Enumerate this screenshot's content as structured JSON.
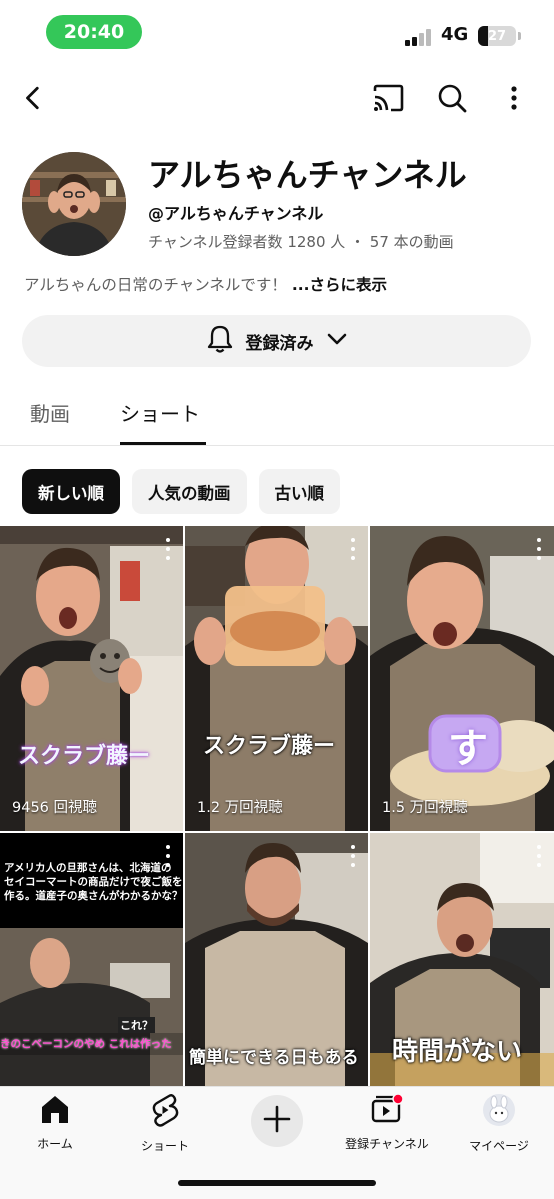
{
  "status_bar": {
    "time": "20:40",
    "network": "4G",
    "battery": "27"
  },
  "topbar": {
    "back_icon": "chevron-left-icon",
    "cast_icon": "cast-icon",
    "search_icon": "search-icon",
    "more_icon": "more-vert-icon"
  },
  "channel": {
    "name": "アルちゃんチャンネル",
    "handle": "@アルちゃんチャンネル",
    "stats": "チャンネル登録者数 1280 人 ・ 57 本の動画",
    "description": "アルちゃんの日常のチャンネルです！",
    "more": "...さらに表示",
    "subscribe_label": "登録済み"
  },
  "tabs": [
    {
      "label": "動画"
    },
    {
      "label": "ショート"
    }
  ],
  "chips": [
    {
      "label": "新しい順"
    },
    {
      "label": "人気の動画"
    },
    {
      "label": "古い順"
    }
  ],
  "shorts": [
    {
      "views": "9456 回視聴",
      "overlay": "スクラブ藤ー"
    },
    {
      "views": "1.2 万回視聴",
      "overlay": "スクラブ藤ー"
    },
    {
      "views": "1.5 万回視聴",
      "overlay": "す"
    },
    {
      "views": "",
      "caption_top": "アメリカ人の旦那さんは、北海道の\nセイコーマートの商品だけで夜ご飯を\n作る。道産子の奥さんがわかるかな？",
      "caption_mid": "これ？",
      "caption_low": "きのこベーコンのやめ これは作った"
    },
    {
      "views": "",
      "overlay": "簡単にできる日もある"
    },
    {
      "views": "",
      "overlay": "時間がない"
    }
  ],
  "bottom_nav": [
    {
      "label": "ホーム",
      "icon": "home-icon"
    },
    {
      "label": "ショート",
      "icon": "shorts-icon"
    },
    {
      "label": "",
      "icon": "plus-icon"
    },
    {
      "label": "登録チャンネル",
      "icon": "subscriptions-icon"
    },
    {
      "label": "マイページ",
      "icon": "profile-avatar-icon"
    }
  ],
  "colors": {
    "accent": "#34c759",
    "text": "#0f0f0f",
    "secondary": "#606060",
    "chip_bg": "#f2f2f2"
  }
}
